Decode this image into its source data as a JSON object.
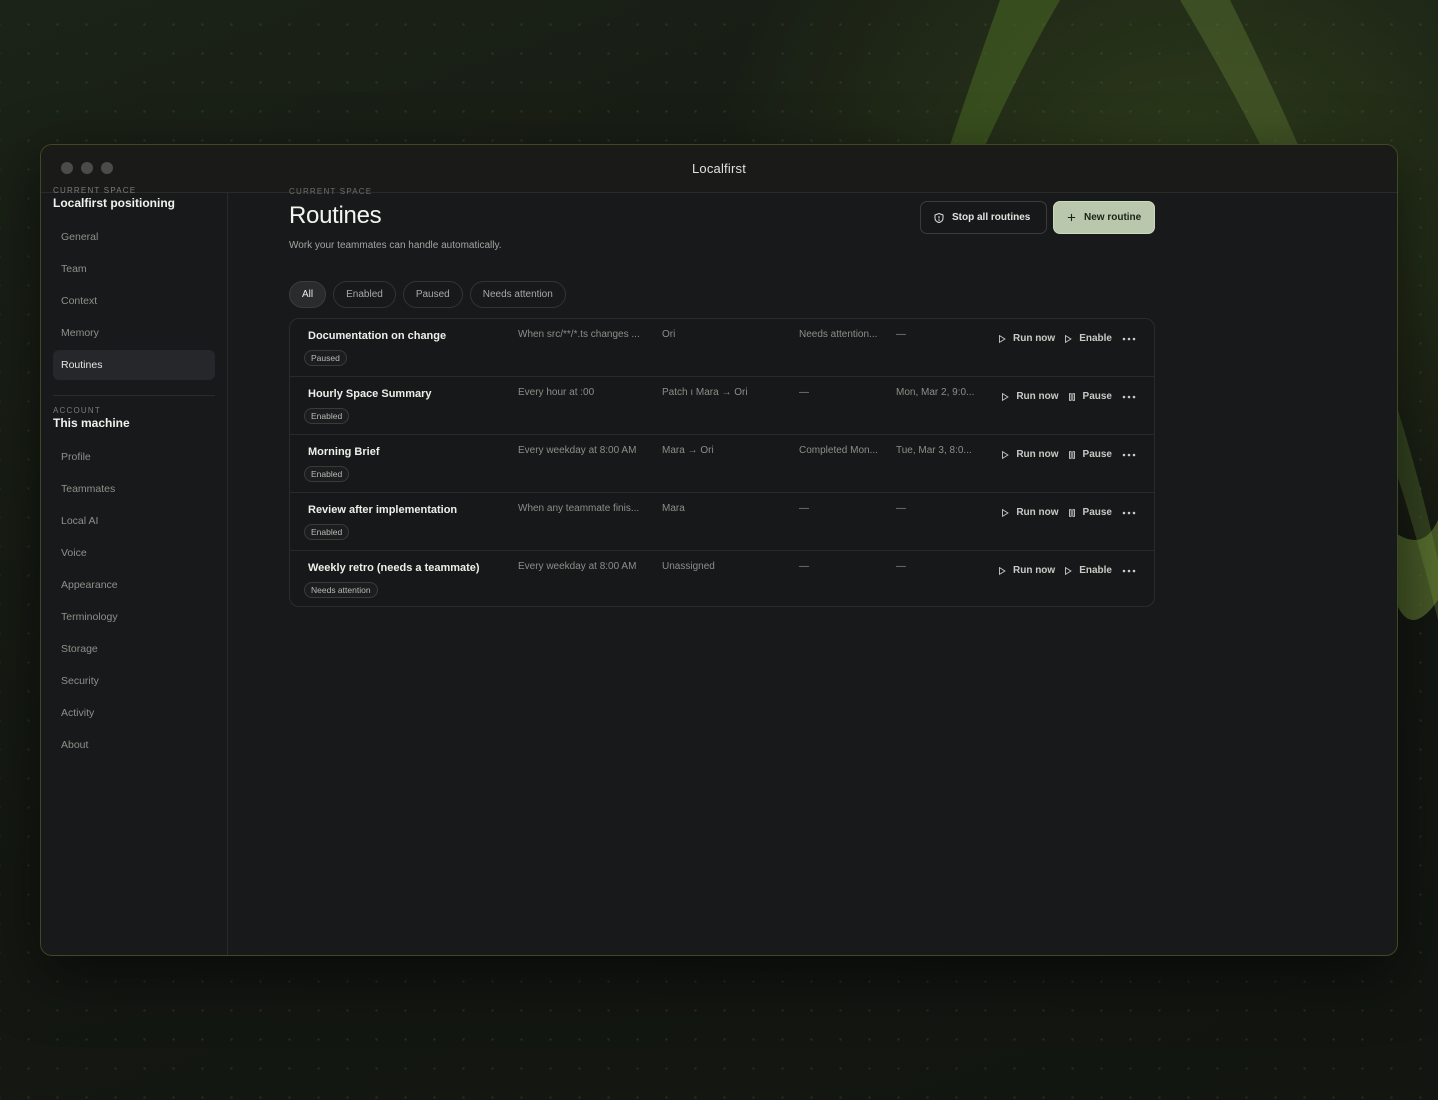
{
  "window": {
    "title": "Localfirst"
  },
  "sidebar": {
    "workspace_label": "CURRENT SPACE",
    "workspace_title": "Localfirst positioning",
    "workspace_items": [
      {
        "label": "General"
      },
      {
        "label": "Team"
      },
      {
        "label": "Context"
      },
      {
        "label": "Memory"
      },
      {
        "label": "Routines",
        "active": true
      }
    ],
    "account_label": "ACCOUNT",
    "account_title": "This machine",
    "account_items": [
      {
        "label": "Profile"
      },
      {
        "label": "Teammates"
      },
      {
        "label": "Local AI"
      },
      {
        "label": "Voice"
      },
      {
        "label": "Appearance"
      },
      {
        "label": "Terminology"
      },
      {
        "label": "Storage"
      },
      {
        "label": "Security"
      },
      {
        "label": "Activity"
      },
      {
        "label": "About"
      }
    ]
  },
  "header": {
    "eyebrow": "CURRENT SPACE",
    "title": "Routines",
    "subtitle": "Work your teammates can handle automatically.",
    "stop_label": "Stop all routines",
    "new_label": "New routine"
  },
  "filters": [
    {
      "label": "All",
      "active": true
    },
    {
      "label": "Enabled"
    },
    {
      "label": "Paused"
    },
    {
      "label": "Needs attention"
    }
  ],
  "routines": [
    {
      "name": "Documentation on change",
      "status": "Paused",
      "trigger": "When src/**/*.ts changes ...",
      "team": "Ori",
      "last": "Needs attention...",
      "next": "—",
      "run_label": "Run now",
      "toggle_label": "Enable"
    },
    {
      "name": "Hourly Space Summary",
      "status": "Enabled",
      "trigger": "Every hour at :00",
      "team": "Patch ı Mara → Ori",
      "last": "—",
      "next": "Mon, Mar 2, 9:0...",
      "run_label": "Run now",
      "toggle_label": "Pause"
    },
    {
      "name": "Morning Brief",
      "status": "Enabled",
      "trigger": "Every weekday at 8:00 AM",
      "team": "Mara → Ori",
      "last": "Completed Mon...",
      "next": "Tue, Mar 3, 8:0...",
      "run_label": "Run now",
      "toggle_label": "Pause"
    },
    {
      "name": "Review after implementation",
      "status": "Enabled",
      "trigger": "When any teammate finis...",
      "team": "Mara",
      "last": "—",
      "next": "—",
      "run_label": "Run now",
      "toggle_label": "Pause"
    },
    {
      "name": "Weekly retro (needs a teammate)",
      "status": "Needs attention",
      "trigger": "Every weekday at 8:00 AM",
      "team": "Unassigned",
      "last": "—",
      "next": "—",
      "run_label": "Run now",
      "toggle_label": "Enable"
    }
  ],
  "colors": {
    "accent": "#b9c7ad",
    "window_border": "#3d4a24",
    "background": "#141812"
  }
}
